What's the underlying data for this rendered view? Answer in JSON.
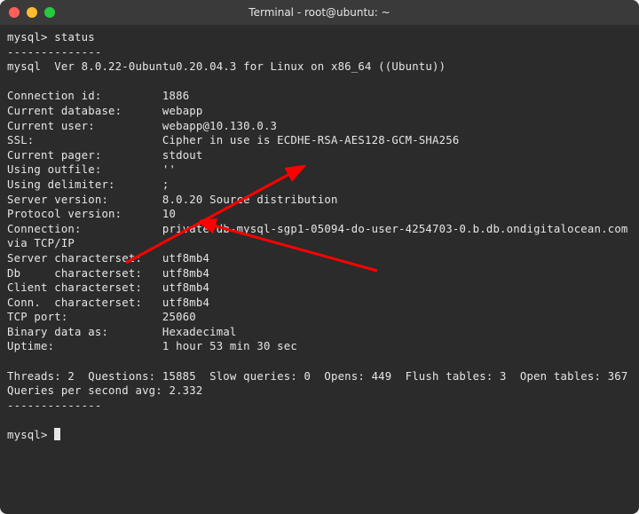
{
  "window": {
    "title": "Terminal - root@ubuntu: ~"
  },
  "prompt": "mysql>",
  "command": "status",
  "div": "--------------",
  "version_line": "mysql  Ver 8.0.22-0ubuntu0.20.04.3 for Linux on x86_64 ((Ubuntu))",
  "status": {
    "connection_id": {
      "label": "Connection id:",
      "value": "1886"
    },
    "current_database": {
      "label": "Current database:",
      "value": "webapp"
    },
    "current_user": {
      "label": "Current user:",
      "value": "webapp@10.130.0.3"
    },
    "ssl": {
      "label": "SSL:",
      "value": "Cipher in use is ECDHE-RSA-AES128-GCM-SHA256"
    },
    "current_pager": {
      "label": "Current pager:",
      "value": "stdout"
    },
    "using_outfile": {
      "label": "Using outfile:",
      "value": "''"
    },
    "using_delimiter": {
      "label": "Using delimiter:",
      "value": ";"
    },
    "server_version": {
      "label": "Server version:",
      "value": "8.0.20 Source distribution"
    },
    "protocol_version": {
      "label": "Protocol version:",
      "value": "10"
    },
    "connection": {
      "label": "Connection:",
      "value": "private-db-mysql-sgp1-05094-do-user-4254703-0.b.db.ondigitalocean.com via TCP/IP"
    },
    "server_charset": {
      "label": "Server characterset:",
      "value": "utf8mb4"
    },
    "db_charset": {
      "label": "Db     characterset:",
      "value": "utf8mb4"
    },
    "client_charset": {
      "label": "Client characterset:",
      "value": "utf8mb4"
    },
    "conn_charset": {
      "label": "Conn.  characterset:",
      "value": "utf8mb4"
    },
    "tcp_port": {
      "label": "TCP port:",
      "value": "25060"
    },
    "binary_data": {
      "label": "Binary data as:",
      "value": "Hexadecimal"
    },
    "uptime": {
      "label": "Uptime:",
      "value": "1 hour 53 min 30 sec"
    }
  },
  "summary": "Threads: 2  Questions: 15885  Slow queries: 0  Opens: 449  Flush tables: 3  Open tables: 367  Queries per second avg: 2.332",
  "colors": {
    "arrow": "#ff0000"
  }
}
